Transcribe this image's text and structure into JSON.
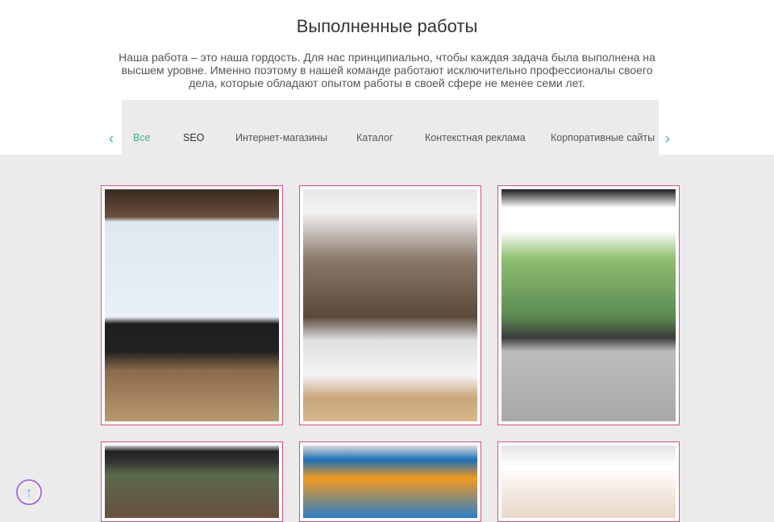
{
  "title": "Выполненные работы",
  "description": "Наша работа – это наша гордость. Для нас принципиально, чтобы каждая задача была выполнена на высшем уровне. Именно поэтому в нашей команде работают исключительно профессионалы своего дела, которые обладают опытом работы в своей сфере не менее семи лет.",
  "tabs": [
    "Все",
    "SEO",
    "Интернет-магазины",
    "Каталог",
    "Контекстная реклама",
    "Корпоративные сайты"
  ],
  "active_tab": "Все",
  "colors": {
    "accent": "#3bb08f",
    "card_border": "#d94c82"
  }
}
